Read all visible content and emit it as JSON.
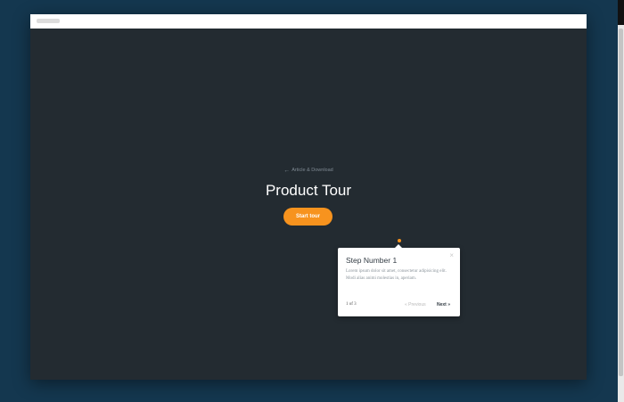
{
  "page": {
    "back_link": "Article & Download",
    "title": "Product Tour",
    "start_button": "Start tour"
  },
  "tour": {
    "step_title": "Step Number 1",
    "step_body": "Lorem ipsum dolor sit amet, consectetur adipisicing elit. Modi alias animi molestias in, aperiam.",
    "counter": "1 of 3",
    "previous": "« Previous",
    "next": "Next »",
    "close": "×"
  },
  "icons": {
    "back": "arrow-left-icon",
    "close": "close-icon"
  },
  "colors": {
    "accent": "#f7931e",
    "page_background": "#232b31",
    "outer_background": "#14374f"
  }
}
